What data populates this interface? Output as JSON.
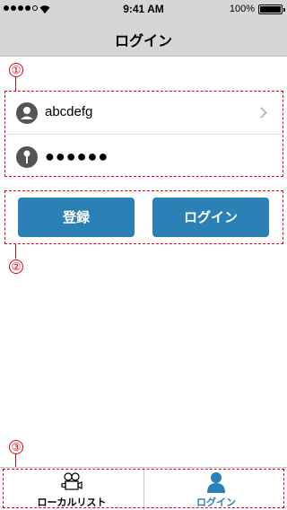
{
  "status_bar": {
    "time": "9:41 AM",
    "battery": "100%"
  },
  "nav": {
    "title": "ログイン"
  },
  "annotations": {
    "one": "①",
    "two": "②",
    "three": "③"
  },
  "login_form": {
    "username": "abcdefg",
    "password_masked": "●●●●●●"
  },
  "buttons": {
    "register": "登録",
    "login": "ログイン"
  },
  "tab_bar": {
    "tabs": [
      {
        "label": "ローカルリスト",
        "icon": "video-camera-icon",
        "active": false
      },
      {
        "label": "ログイン",
        "icon": "person-icon",
        "active": true
      }
    ]
  },
  "colors": {
    "accent": "#2b80b6",
    "annotation": "#e60012",
    "bar": "#d6d6d9"
  }
}
